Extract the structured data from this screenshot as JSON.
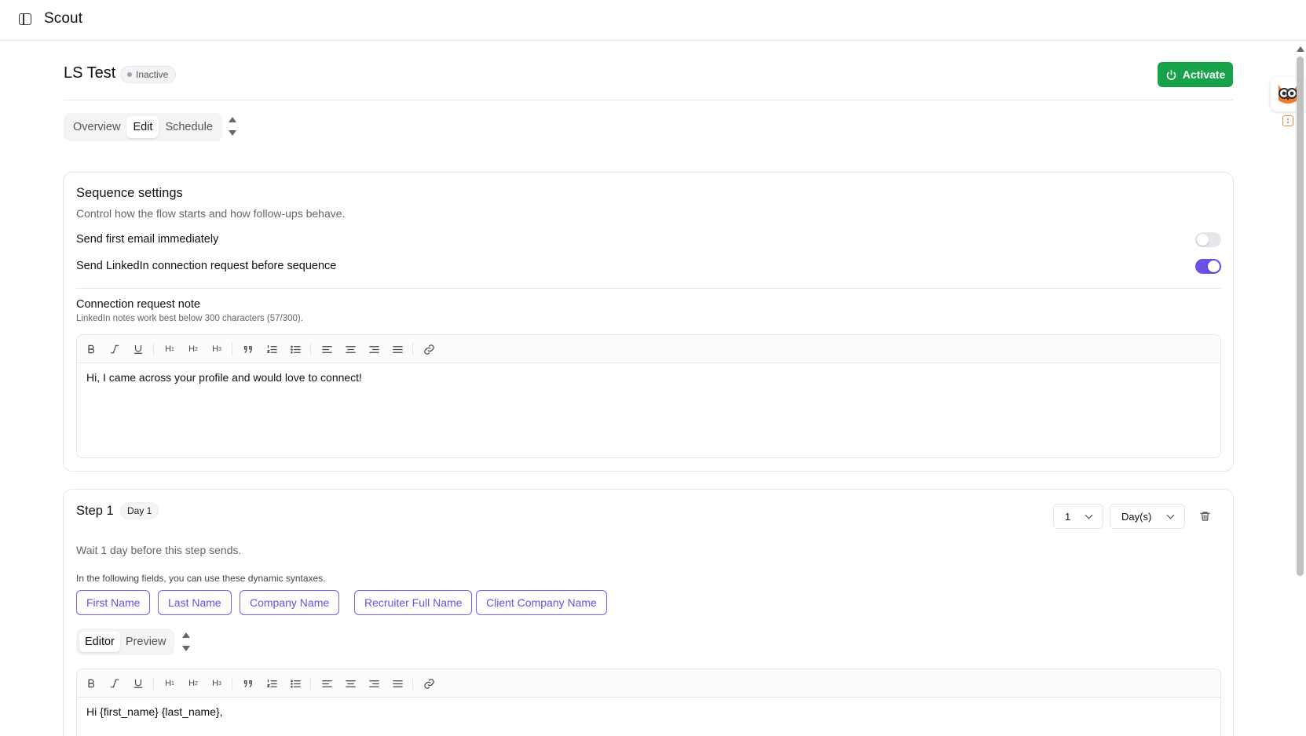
{
  "app": {
    "title": "Scout"
  },
  "header": {
    "title": "LS Test",
    "status": "Inactive",
    "activate_label": "Activate",
    "accent_color": "#16a34a"
  },
  "tabs": [
    {
      "label": "Overview",
      "active": false
    },
    {
      "label": "Edit",
      "active": true
    },
    {
      "label": "Schedule",
      "active": false
    }
  ],
  "sequence_settings": {
    "title": "Sequence settings",
    "subtitle": "Control how the flow starts and how follow-ups behave.",
    "send_first_email_label": "Send first email immediately",
    "send_first_email_on": false,
    "linkedin_label": "Send LinkedIn connection request before sequence",
    "linkedin_on": true,
    "toggle_on_color": "#6d4ee6",
    "note_label": "Connection request note",
    "note_hint": "LinkedIn notes work best below 300 characters (57/300).",
    "note_text": "Hi, I came across your profile and would love to connect!"
  },
  "toolbar": {
    "bold": "B",
    "italic": "I",
    "underline": "U",
    "h1": "H1",
    "h2": "H2",
    "h3": "H3",
    "icons": [
      "bold-icon",
      "italic-icon",
      "underline-icon",
      "heading1-icon",
      "heading2-icon",
      "heading3-icon",
      "quote-icon",
      "ordered-list-icon",
      "bullet-list-icon",
      "align-left-icon",
      "align-center-icon",
      "align-right-icon",
      "align-justify-icon",
      "link-icon"
    ]
  },
  "step1": {
    "title": "Step 1",
    "day_badge": "Day 1",
    "delay_value": "1",
    "delay_unit": "Day(s)",
    "wait_text": "Wait 1 day before this step sends.",
    "syntax_hint": "In the following fields, you can use these dynamic syntaxes.",
    "chips": [
      "First Name",
      "Last Name",
      "Company Name",
      "Recruiter Full Name",
      "Client Company Name"
    ],
    "subtabs": [
      {
        "label": "Editor",
        "active": true
      },
      {
        "label": "Preview",
        "active": false
      }
    ],
    "body_text": "Hi {first_name} {last_name},"
  }
}
